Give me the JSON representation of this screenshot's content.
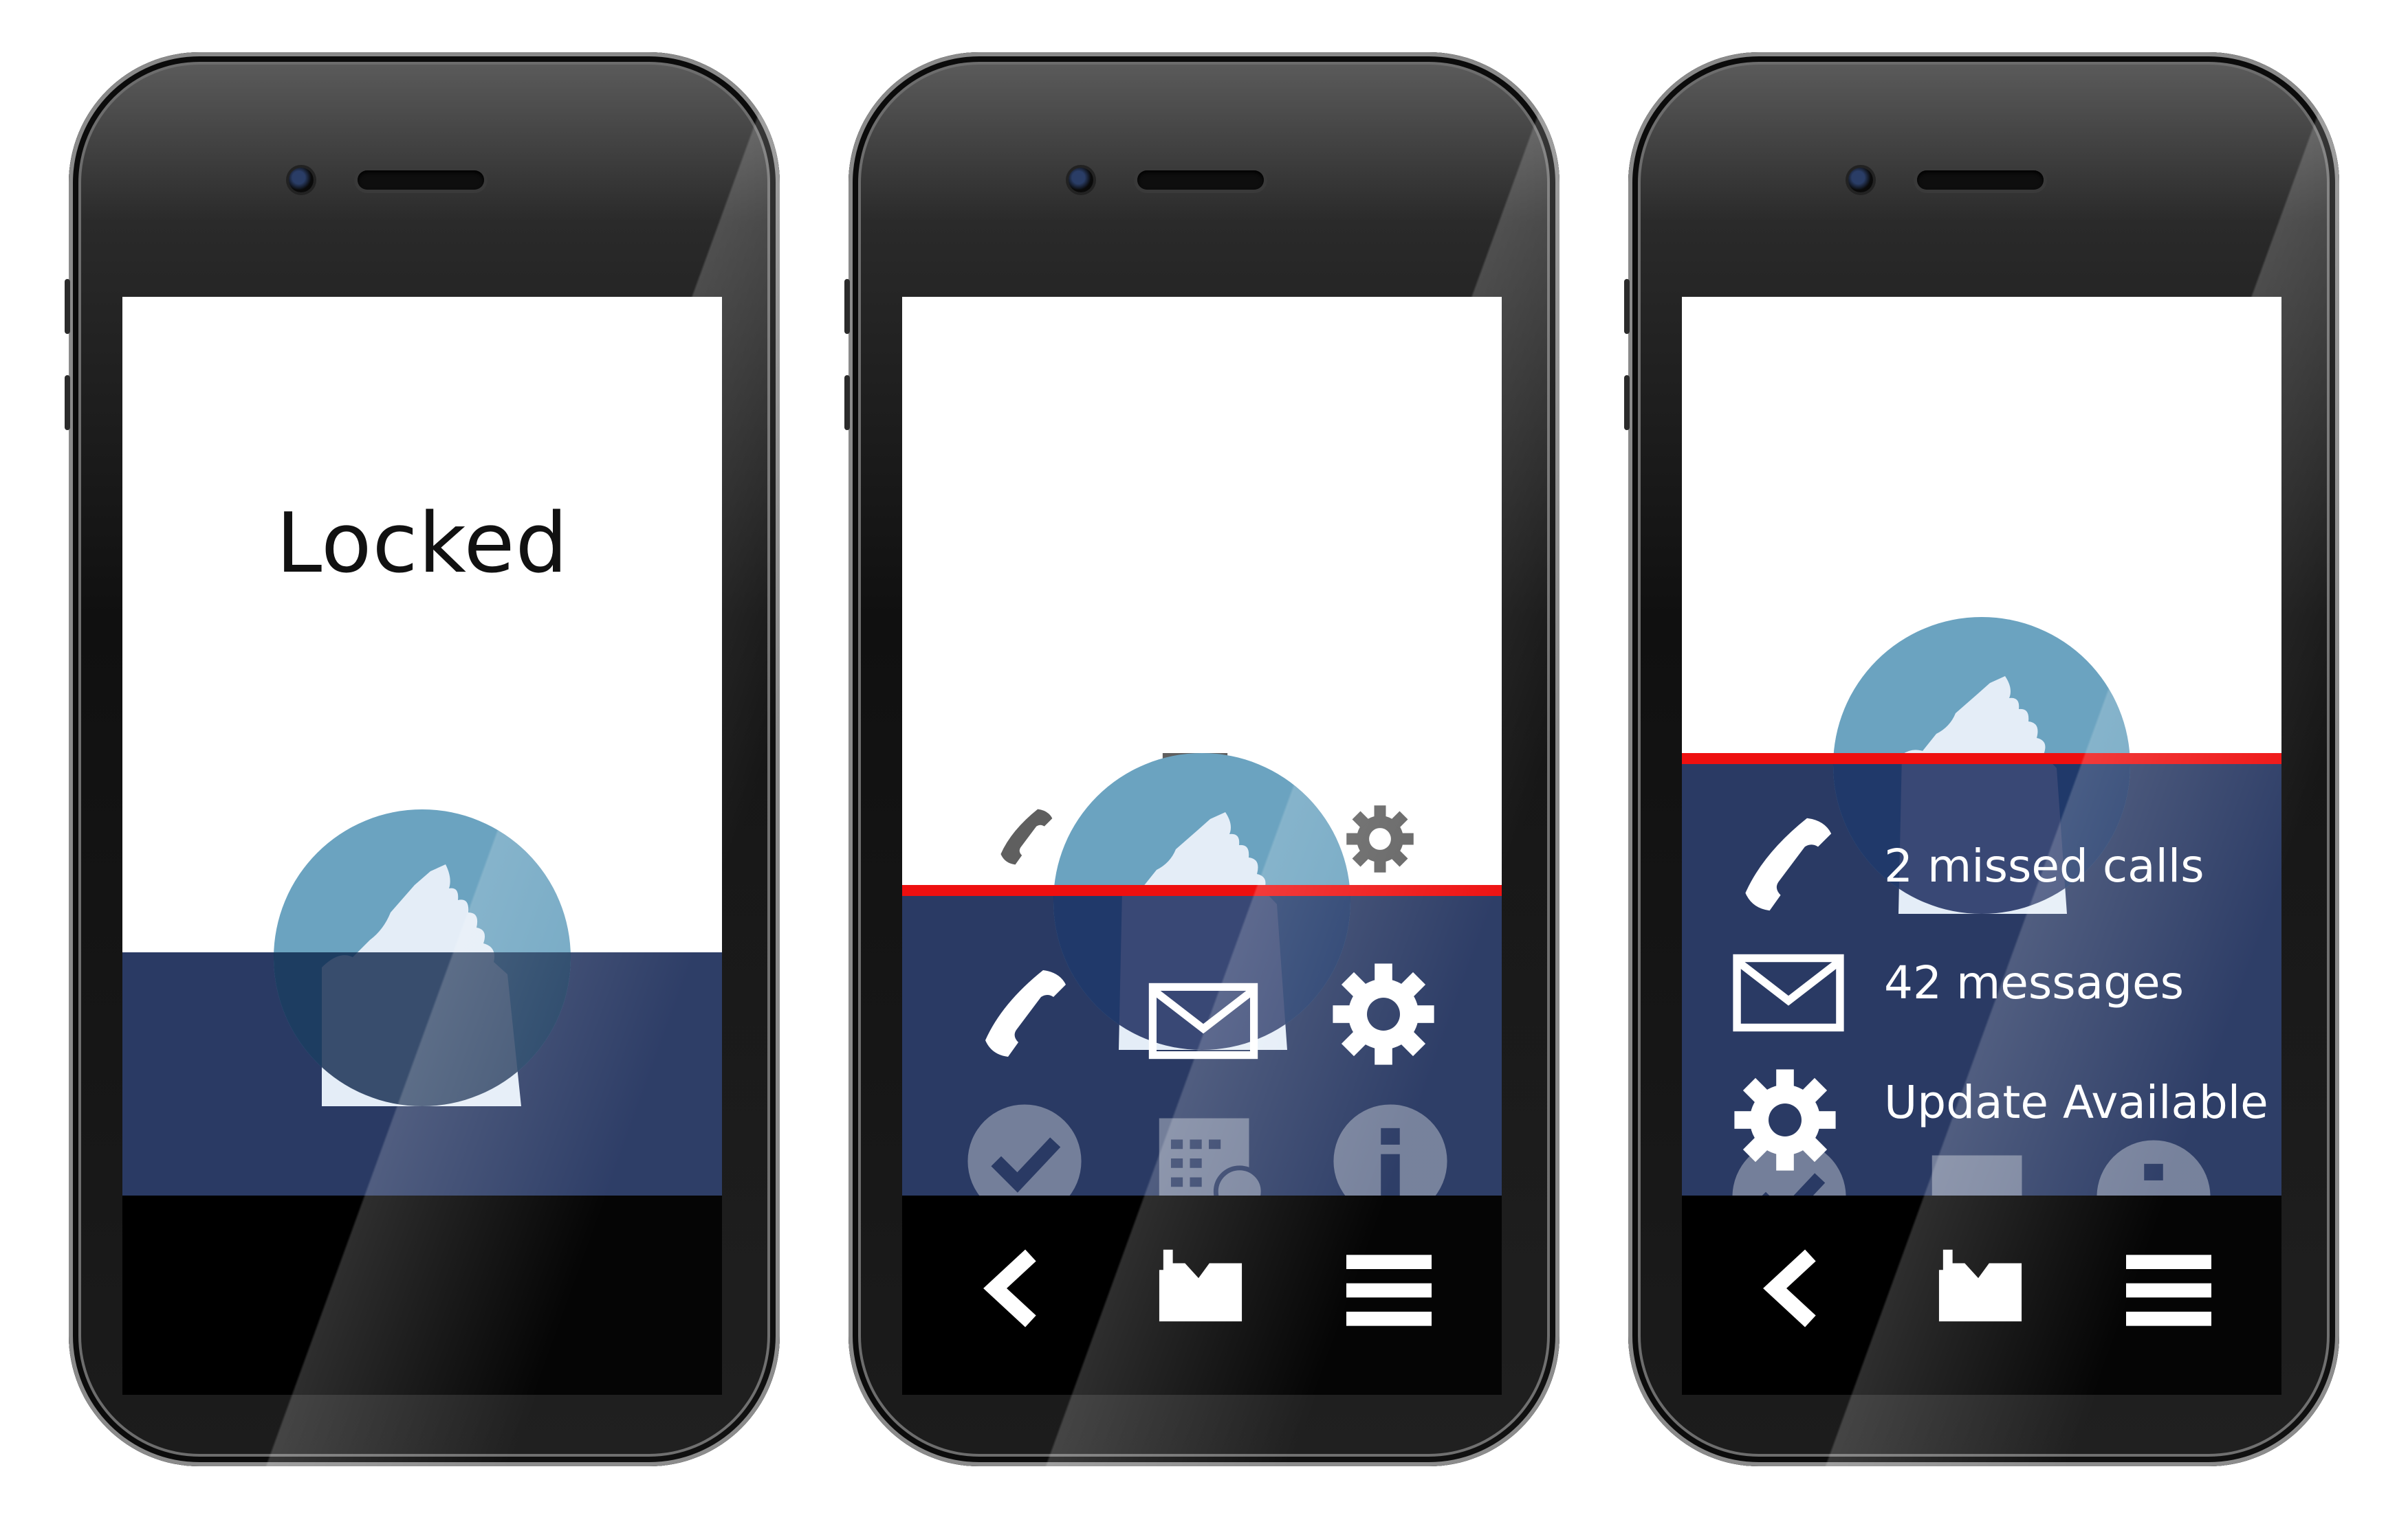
{
  "colors": {
    "navy": "#2a3a64",
    "berg_blue": "#6ba3c0",
    "ice": "#e4edf7",
    "red_line": "#ee0f0f",
    "gray_icon": "#5f5f5f"
  },
  "screen1": {
    "title": "Locked",
    "icons": [
      "iceberg-logo"
    ]
  },
  "screen2": {
    "peek_icons": [
      "mail-icon",
      "phone-icon",
      "gear-icon"
    ],
    "grid_icons": [
      "phone-icon",
      "mail-icon",
      "gear-icon",
      "check-icon",
      "calendar-icon",
      "info-icon"
    ],
    "nav_icons": [
      "back-icon",
      "folder-icon",
      "menu-icon"
    ]
  },
  "screen3": {
    "notifications": [
      {
        "icon": "phone-icon",
        "text": "2 missed calls"
      },
      {
        "icon": "mail-icon",
        "text": "42 messages"
      },
      {
        "icon": "gear-icon",
        "text": "Update Available"
      }
    ],
    "faded_icons": [
      "check-icon",
      "calendar-icon",
      "info-icon"
    ],
    "nav_icons": [
      "back-icon",
      "folder-icon",
      "menu-icon"
    ]
  }
}
